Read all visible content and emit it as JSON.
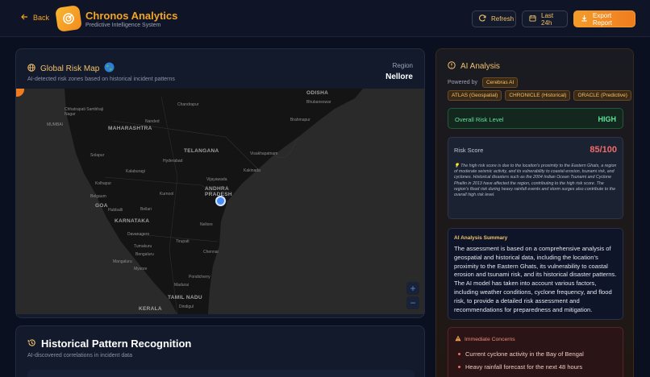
{
  "header": {
    "back_label": "Back",
    "brand_title": "Chronos Analytics",
    "brand_subtitle": "Predictive Intelligence System",
    "refresh_label": "Refresh",
    "range_label": "Last 24h",
    "export_label": "Export Report"
  },
  "map_panel": {
    "title": "Global Risk Map",
    "subtitle": "AI-detected risk zones based on historical incident patterns",
    "region_label": "Region",
    "region_value": "Nellore",
    "zoom_in": "+",
    "zoom_out": "−",
    "states": [
      "MAHARASHTRA",
      "TELANGANA",
      "ODISHA",
      "ANDHRA PRADESH",
      "KARNATAKA",
      "TAMIL NADU",
      "KERALA",
      "GOA"
    ],
    "cities": [
      "Chandrapur",
      "Nanded",
      "Hyderabad",
      "Vijayawada",
      "Visakhapatnam",
      "Kurnool",
      "Bengaluru",
      "Chennai",
      "Madurai",
      "Solapur",
      "Bellari",
      "MUMBAI",
      "Bhubaneswar",
      "Brahmapur",
      "Kakinada",
      "Nellore",
      "Tirupati",
      "Pondicherry",
      "Mysore",
      "Kolhapur",
      "Belgaum",
      "Dindigul",
      "Chhatrapati Sambhaji Nagar",
      "Hubballi",
      "Davanagere",
      "Tumakuru",
      "Mangaluru",
      "Kalaburagi"
    ]
  },
  "history_panel": {
    "title": "Historical Pattern Recognition",
    "subtitle": "AI-discovered correlations in incident data"
  },
  "ai_panel": {
    "title": "AI Analysis",
    "powered_label": "Powered by",
    "powered_chip": "Cerebras AI",
    "chips": [
      "ATLAS (Geospatial)",
      "CHRONICLE (Historical)",
      "ORACLE (Predictive)"
    ],
    "risk_level_label": "Overall Risk Level",
    "risk_level_value": "HIGH",
    "risk_score_label": "Risk Score",
    "risk_score_value": "85/100",
    "risk_score_desc": "💡 The high risk score is due to the location's proximity to the Eastern Ghats, a region of moderate seismic activity, and its vulnerability to coastal erosion, tsunami risk, and cyclones. Historical disasters such as the 2004 Indian Ocean Tsunami and Cyclone Phailin in 2013 have affected the region, contributing to the high risk score. The region's flood risk during heavy rainfall events and storm surges also contribute to the overall high risk level.",
    "summary_label": "AI Analysis Summary",
    "summary_text": "The assessment is based on a comprehensive analysis of geospatial and historical data, including the location's proximity to the Eastern Ghats, its vulnerability to coastal erosion and tsunami risk, and its historical disaster patterns. The AI model has taken into account various factors, including weather conditions, cyclone frequency, and flood risk, to provide a detailed risk assessment and recommendations for preparedness and mitigation.",
    "concerns_label": "Immediate Concerns",
    "concerns": [
      "Current cyclone activity in the Bay of Bengal",
      "Heavy rainfall forecast for the next 48 hours"
    ]
  },
  "colors": {
    "accent": "#f5a524",
    "risk_high": "#5fe39a",
    "risk_score": "#f06b6b",
    "marker": "#4a8df7"
  }
}
